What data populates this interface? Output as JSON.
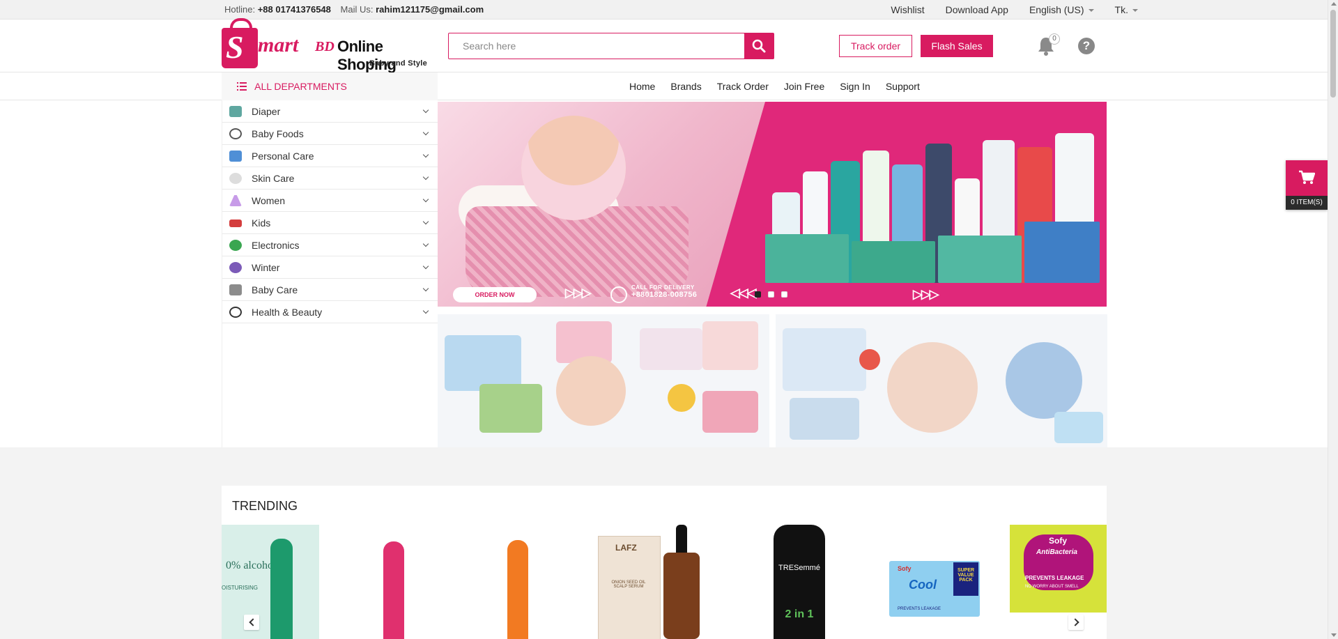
{
  "topbar": {
    "hotline_label": "Hotline:",
    "hotline": "+88 01741376548",
    "mail_label": "Mail Us:",
    "mail": "rahim121175@gmail.com",
    "wishlist": "Wishlist",
    "download_app": "Download App",
    "language": "English (US)",
    "currency": "Tk."
  },
  "header": {
    "logo": {
      "s": "S",
      "part1": "mart",
      "part2": "BD",
      "part3": "Online Shoping",
      "tagline": "Baby and Style"
    },
    "search_placeholder": "Search here",
    "track_order": "Track order",
    "flash_sales": "Flash Sales",
    "notification_count": "0",
    "help_icon": "question-icon",
    "colors": {
      "brand": "#d81b60"
    }
  },
  "navbar": {
    "all_departments": "ALL DEPARTMENTS",
    "links": [
      "Home",
      "Brands",
      "Track Order",
      "Join Free",
      "Sign In",
      "Support"
    ]
  },
  "categories": [
    {
      "label": "Diaper",
      "icon": "diaper-icon"
    },
    {
      "label": "Baby Foods",
      "icon": "baby-food-icon"
    },
    {
      "label": "Personal Care",
      "icon": "personal-care-icon"
    },
    {
      "label": "Skin Care",
      "icon": "skin-care-icon"
    },
    {
      "label": "Women",
      "icon": "dress-icon"
    },
    {
      "label": "Kids",
      "icon": "toy-car-icon"
    },
    {
      "label": "Electronics",
      "icon": "electronics-icon"
    },
    {
      "label": "Winter",
      "icon": "winter-icon"
    },
    {
      "label": "Baby Care",
      "icon": "baby-care-icon"
    },
    {
      "label": "Health & Beauty",
      "icon": "health-beauty-icon"
    }
  ],
  "hero": {
    "order_now": "ORDER NOW",
    "call_for_delivery": "CALL FOR DELIVERY",
    "phone": "+8801828-008756",
    "slides_total": 3,
    "active_slide": 1
  },
  "cart": {
    "label": "0 ITEM(S)"
  },
  "trending": {
    "title": "TRENDING",
    "items": [
      {
        "name": "spray-green"
      },
      {
        "name": "spray-pink"
      },
      {
        "name": "spray-orange"
      },
      {
        "name": "serum"
      },
      {
        "name": "shampoo"
      },
      {
        "name": "sofy-cool-pack"
      },
      {
        "name": "sofy-antibacteria-pack"
      }
    ],
    "item_texts": {
      "alcohol": "0% alcohol",
      "moist": "OISTURISING",
      "lafz": "LAFZ",
      "onion": "ONION SEED OIL SCALP SERUM",
      "tresemme": "TRESemmé",
      "two_in_one": "2 in 1",
      "sofy": "Sofy",
      "cool": "Cool",
      "super_value": "SUPER VALUE PACK",
      "prevents": "PREVENTS LEAKAGE",
      "antibacteria": "AntiBacteria",
      "no_worry": "NO WORRY ABOUT SMELL"
    }
  }
}
